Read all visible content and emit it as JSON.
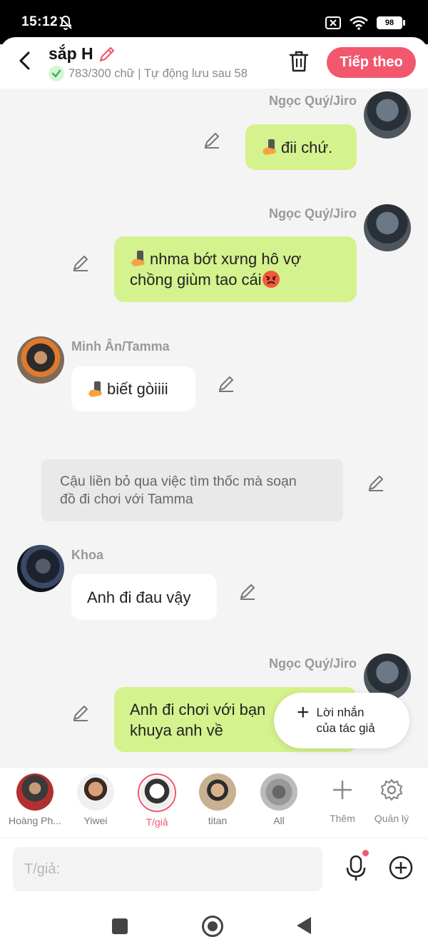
{
  "status_bar": {
    "time": "15:12",
    "battery": "98"
  },
  "header": {
    "title": "sắp H",
    "subtitle": "783/300 chữ | Tự động lưu sau 58",
    "next_label": "Tiếp theo"
  },
  "messages": [
    {
      "sender": "Ngọc Quý/Jiro",
      "text": "đii chứ."
    },
    {
      "sender": "Ngọc Quý/Jiro",
      "line1": "nhma bớt xưng hô vợ",
      "line2": "chồng giùm tao cái"
    },
    {
      "sender": "Minh Ân/Tamma",
      "text": "biết gòiiii"
    },
    {
      "narration_line1": "Cậu liền bỏ qua việc tìm thốc mà soạn",
      "narration_line2": "đồ đi chơi với Tamma"
    },
    {
      "sender": "Khoa",
      "text": "Anh đi đau vậy"
    },
    {
      "sender": "Ngọc Quý/Jiro",
      "line1": "Anh đi chơi với bạn",
      "line2": "khuya anh về"
    }
  ],
  "author_note": {
    "line1": "Lời nhắn",
    "line2": "của tác giả"
  },
  "characters": [
    {
      "label": "Hoàng Ph..."
    },
    {
      "label": "Yiwei"
    },
    {
      "label": "T/giả"
    },
    {
      "label": "titan"
    },
    {
      "label": "All"
    }
  ],
  "tools": {
    "add_label": "Thêm",
    "manage_label": "Quản lý"
  },
  "input": {
    "placeholder": "T/giả:"
  },
  "colors": {
    "accent": "#f2576e",
    "green_bubble": "#d4f28d",
    "narration_bg": "#e9e9e9"
  }
}
